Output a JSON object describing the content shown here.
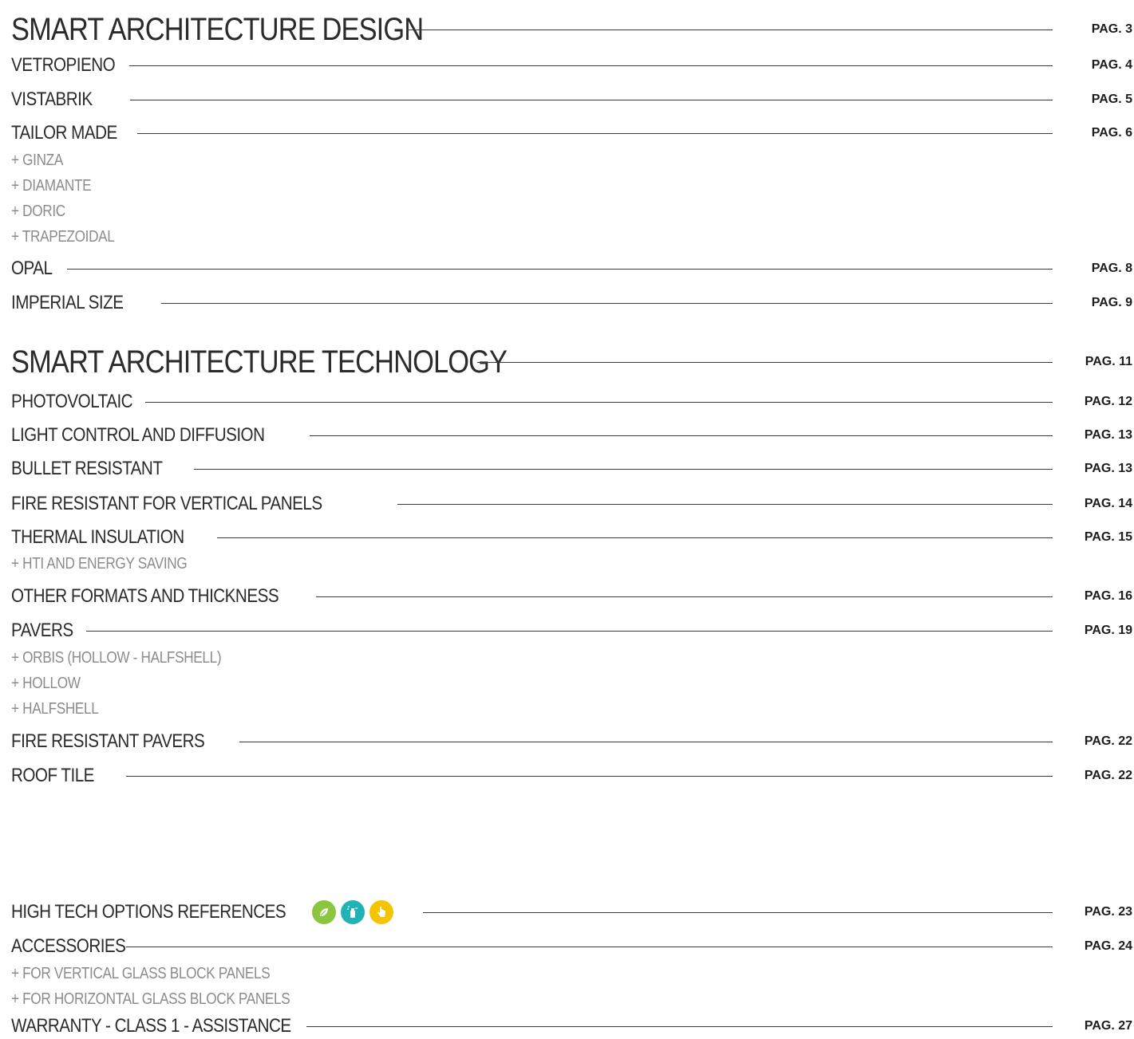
{
  "sections": [
    {
      "title": "SMART ARCHITECTURE DESIGN",
      "page": "PAG. 3",
      "items": [
        {
          "title": "VETROPIENO",
          "page": "PAG. 4"
        },
        {
          "title": "VISTABRIK",
          "page": "PAG. 5"
        },
        {
          "title": "TAILOR MADE",
          "page": "PAG. 6",
          "subitems": [
            "+ GINZA",
            "+ DIAMANTE",
            "+ DORIC",
            "+ TRAPEZOIDAL"
          ]
        },
        {
          "title": "OPAL",
          "page": "PAG. 8"
        },
        {
          "title": "IMPERIAL SIZE",
          "page": "PAG. 9"
        }
      ]
    },
    {
      "title": "SMART ARCHITECTURE TECHNOLOGY",
      "page": "PAG. 11",
      "items": [
        {
          "title": "PHOTOVOLTAIC",
          "page": "PAG. 12"
        },
        {
          "title": "LIGHT CONTROL AND DIFFUSION",
          "page": "PAG. 13"
        },
        {
          "title": "BULLET RESISTANT",
          "page": "PAG. 13"
        },
        {
          "title": "FIRE RESISTANT FOR VERTICAL PANELS",
          "page": "PAG. 14"
        },
        {
          "title": "THERMAL INSULATION",
          "page": "PAG. 15",
          "subitems": [
            "+ HTI AND ENERGY SAVING"
          ]
        },
        {
          "title": "OTHER FORMATS AND THICKNESS",
          "page": "PAG. 16"
        },
        {
          "title": "PAVERS",
          "page": "PAG. 19",
          "subitems": [
            "+ ORBIS (HOLLOW - HALFSHELL)",
            "+ HOLLOW",
            "+ HALFSHELL"
          ]
        },
        {
          "title": "FIRE RESISTANT PAVERS",
          "page": "PAG. 22"
        },
        {
          "title": "ROOF TILE",
          "page": "PAG. 22"
        }
      ]
    },
    {
      "items": [
        {
          "title": "HIGH TECH OPTIONS REFERENCES",
          "page": "PAG. 23",
          "icons": [
            "leaf-icon",
            "spray-bottle-icon",
            "hand-touch-icon"
          ]
        },
        {
          "title": "ACCESSORIES",
          "page": "PAG. 24",
          "subitems": [
            "+ FOR VERTICAL GLASS BLOCK PANELS",
            "+ FOR HORIZONTAL GLASS BLOCK PANELS"
          ]
        },
        {
          "title": "WARRANTY - CLASS 1 - ASSISTANCE",
          "page": "PAG. 27"
        }
      ]
    }
  ],
  "colors": {
    "leaf": "#8cc63f",
    "spray": "#1fb3b5",
    "hand": "#f5c400"
  }
}
